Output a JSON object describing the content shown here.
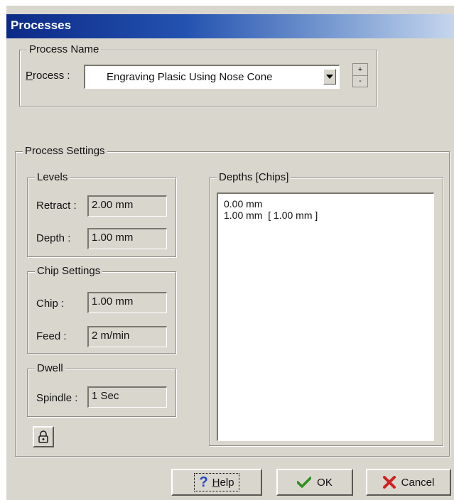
{
  "window": {
    "title": "Processes"
  },
  "process_name": {
    "group_label": "Process Name",
    "process_label_accel": "P",
    "process_label_rest": "rocess :",
    "selected_process": "Engraving Plasic Using Nose Cone"
  },
  "process_settings": {
    "group_label": "Process Settings",
    "levels": {
      "group_label": "Levels",
      "retract_label": "Retract :",
      "retract_value": "2.00 mm",
      "depth_label": "Depth :",
      "depth_value": "1.00 mm"
    },
    "chip_settings": {
      "group_label": "Chip Settings",
      "chip_label": "Chip :",
      "chip_value": "1.00 mm",
      "feed_label": "Feed :",
      "feed_value": "2 m/min"
    },
    "dwell": {
      "group_label": "Dwell",
      "spindle_label": "Spindle :",
      "spindle_value": "1 Sec"
    },
    "depths": {
      "group_label": "Depths [Chips]",
      "items": [
        "0.00 mm",
        "1.00 mm  [ 1.00 mm ]"
      ]
    }
  },
  "buttons": {
    "help_accel": "H",
    "help_rest": "elp",
    "ok": "OK",
    "cancel": "Cancel"
  },
  "colors": {
    "face": "#d9d6ce",
    "title_start": "#0c2a86",
    "title_end": "#c5d6ee",
    "help_icon": "#2344c9",
    "ok_check": "#2f8f1f",
    "cancel_x": "#d02020"
  },
  "icons": {
    "combo_arrow": "chevron-down-icon",
    "spin": "spin-up-down-icon",
    "tool": "lock-icon",
    "help": "question-icon",
    "ok": "checkmark-icon",
    "cancel": "x-icon"
  }
}
